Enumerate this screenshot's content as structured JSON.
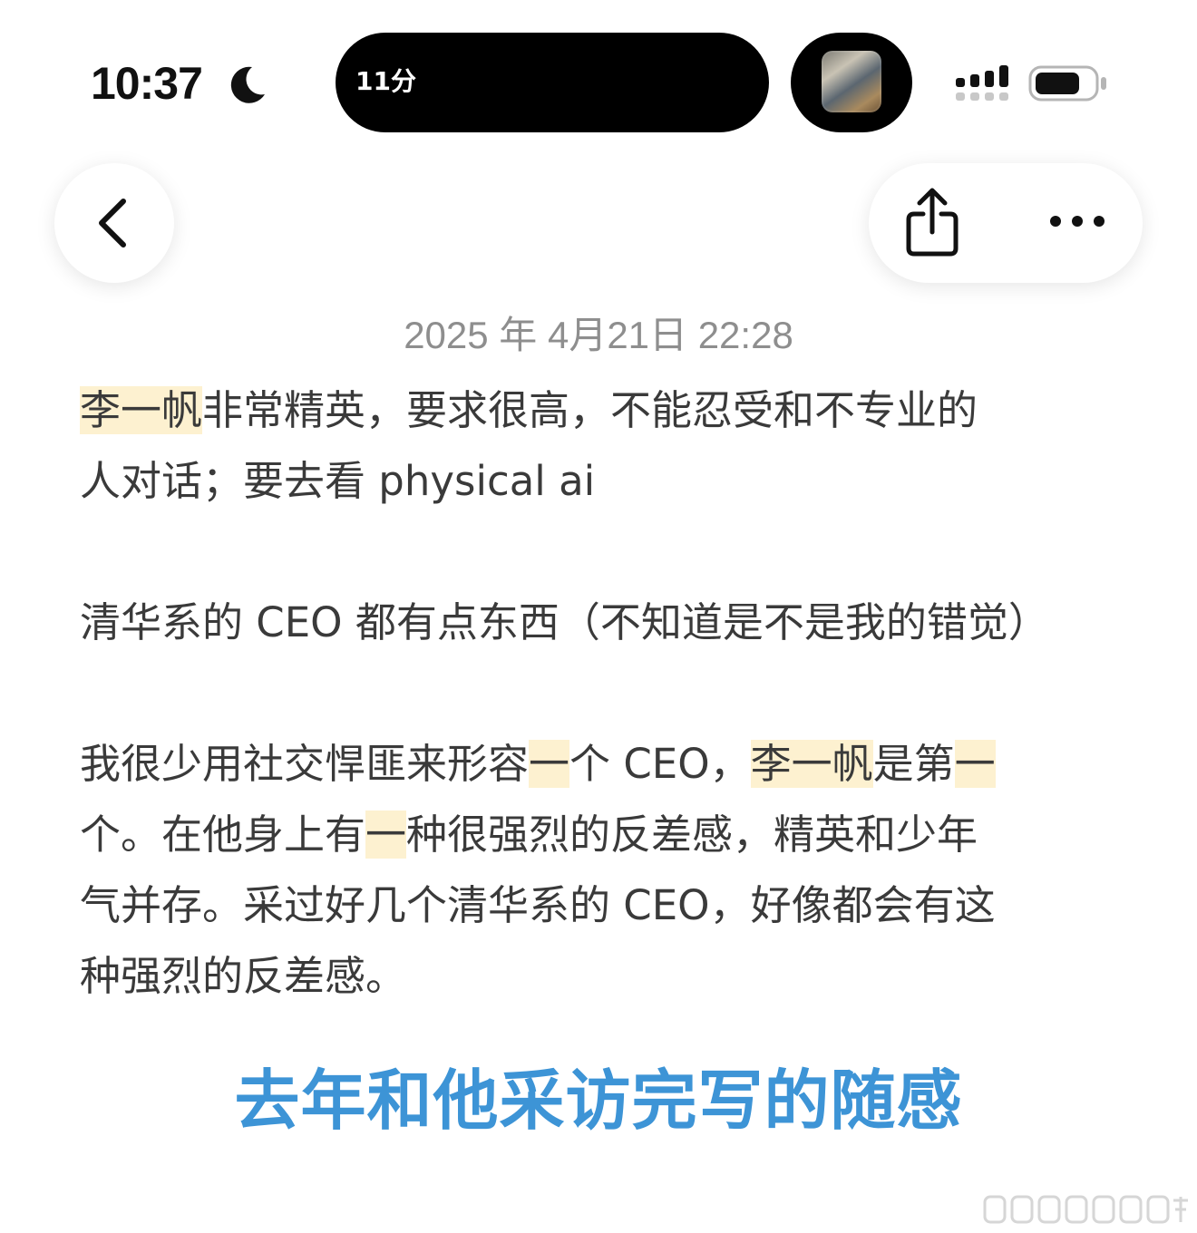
{
  "status_bar": {
    "time": "10:37",
    "island_text": "11分",
    "focus_icon": "moon-icon",
    "signal_icon": "cellular-signal-icon",
    "battery_icon": "battery-icon"
  },
  "nav": {
    "back_icon": "chevron-left-icon",
    "share_icon": "share-icon",
    "more_icon": "ellipsis-icon"
  },
  "post": {
    "date": "2025 年 4月21日 22:28",
    "p1_line1": {
      "hl": "李一帆",
      "rest": "非常精英，要求很高，不能忍受和不专业的"
    },
    "p1_line2": "人对话；要去看 physical ai",
    "p2_line1": "清华系的 CEO 都有点东西（不知道是不是我的错觉）",
    "p3_line1": {
      "a": "我很少用社交悍匪来形容",
      "hl1": "一",
      "b": "个 CEO，",
      "hl2": "李一帆",
      "c": "是第",
      "hl3": "一"
    },
    "p3_line2": {
      "a": "个。在他身上有",
      "hl": "一",
      "b": "种很强烈的反差感，精英和少年"
    },
    "p3_line3": "气并存。采过好几个清华系的 CEO，好像都会有这",
    "p3_line4": "种强烈的反差感。",
    "headline": "去年和他采访完写的随感"
  },
  "colors": {
    "highlight": "#fdf1d0",
    "headline": "#3d94d6",
    "date": "#8e8e8e",
    "body_text": "#3a3a3a"
  }
}
